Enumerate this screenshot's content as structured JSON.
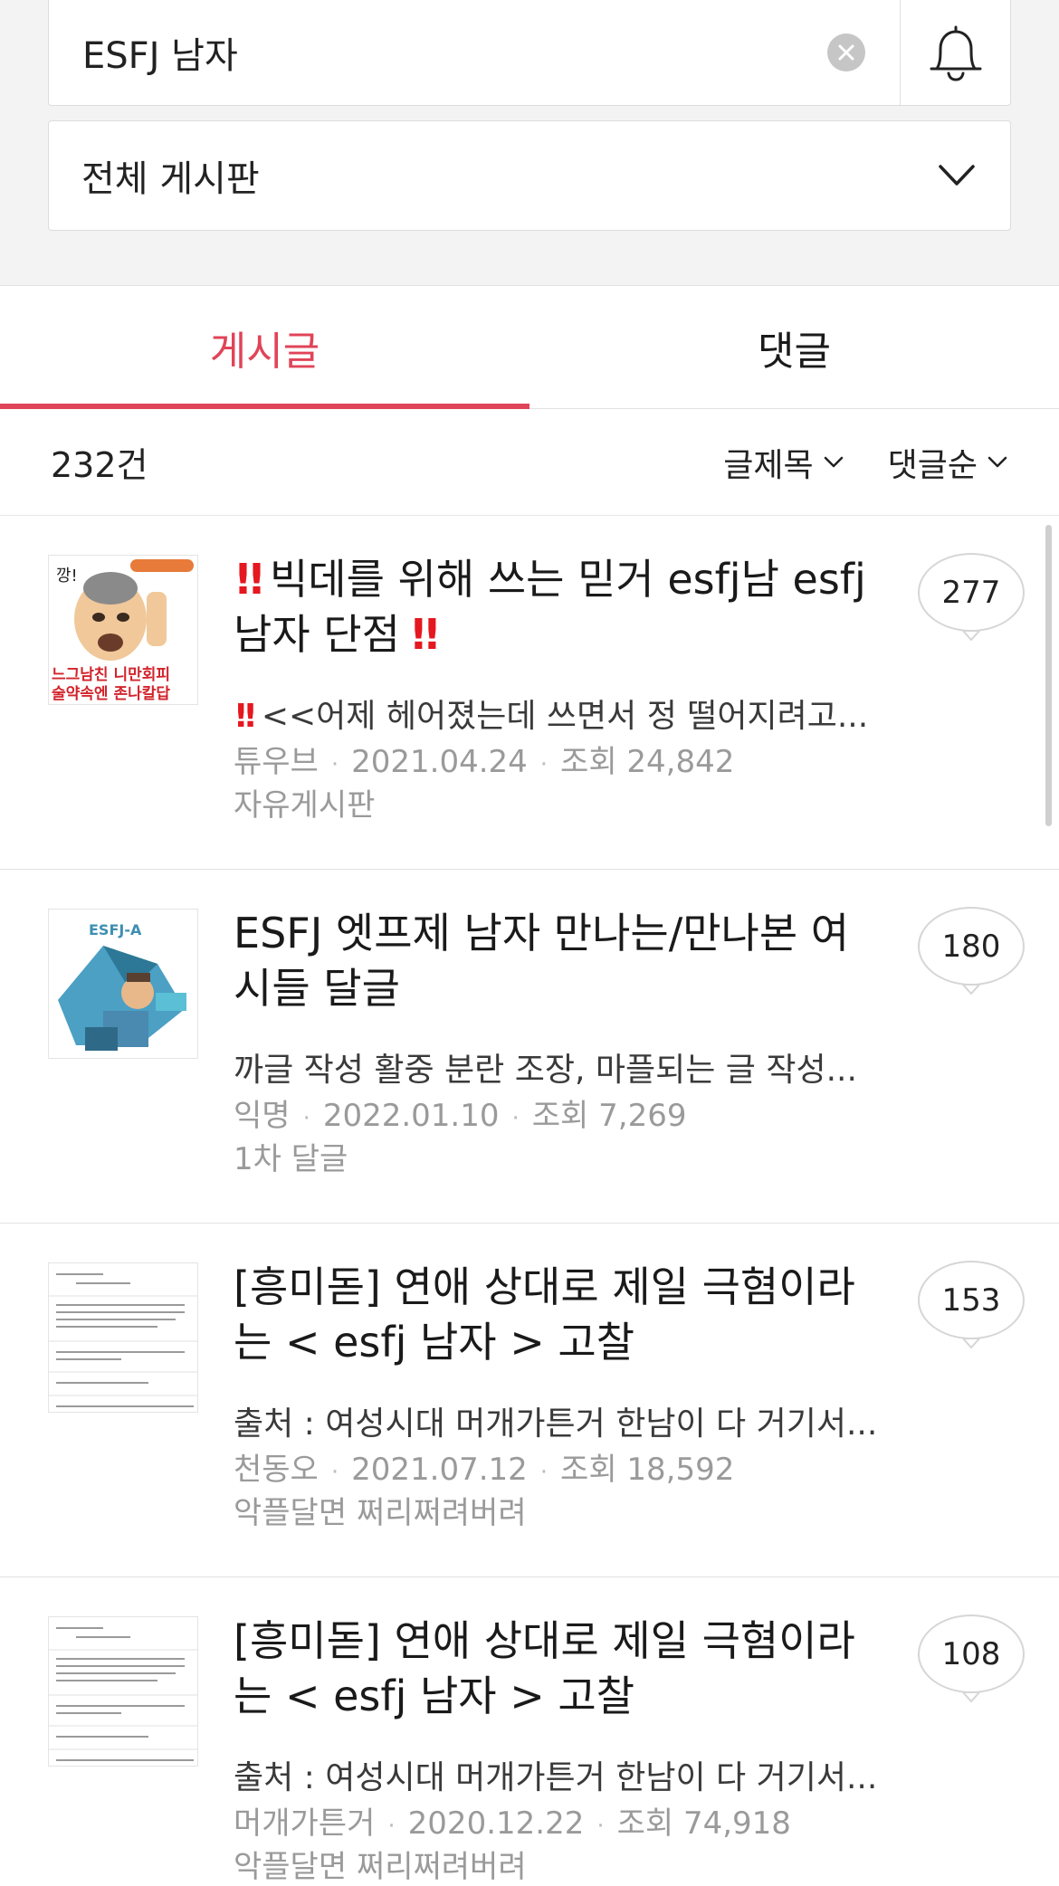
{
  "search": {
    "value": "ESFJ 남자",
    "board_filter": "전체 게시판"
  },
  "tabs": [
    {
      "label": "게시글",
      "active": true
    },
    {
      "label": "댓글",
      "active": false
    }
  ],
  "results": {
    "count": "232건",
    "sort_field": "글제목",
    "sort_order": "댓글순"
  },
  "posts": [
    {
      "title": "빅데를 위해 쓰는 믿거 esfj남 esfj 남자 단점",
      "title_prefix": "!!",
      "title_suffix": "!!",
      "preview": "<<어제 헤어졌는데 쓰면서 정 떨어지려고...",
      "preview_prefix": "!!",
      "author": "튜우브",
      "date": "2021.04.24",
      "views": "조회 24,842",
      "board": "자유게시판",
      "comments": "277",
      "thumb_text_top": "깡!",
      "thumb_text_bottom": "느그남친 니만회피 술약속엔 존나칼답"
    },
    {
      "title": "ESFJ 엣프제 남자 만나는/만나본 여시들 달글",
      "preview": "까글 작성 활중 분란 조장, 마플되는 글 작성...",
      "author": "익명",
      "date": "2022.01.10",
      "views": "조회 7,269",
      "board": "1차 달글",
      "comments": "180",
      "thumb_text_top": "ESFJ-A"
    },
    {
      "title": "[흥미돋] 연애 상대로 제일 극혐이라는 < esfj 남자 > 고찰",
      "preview": "출처 : 여성시대 머개가튼거 한남이 다 거기서...",
      "author": "천동오",
      "date": "2021.07.12",
      "views": "조회 18,592",
      "board": "악플달면 쩌리쩌려버려",
      "comments": "153"
    },
    {
      "title": "[흥미돋] 연애 상대로 제일 극혐이라는 < esfj 남자 > 고찰",
      "preview": "출처 : 여성시대 머개가튼거 한남이 다 거기서...",
      "author": "머개가튼거",
      "date": "2020.12.22",
      "views": "조회 74,918",
      "board": "악플달면 쩌리쩌려버려",
      "comments": "108"
    }
  ],
  "colors": {
    "accent": "#e04458",
    "background": "#f3f3f3",
    "meta_text": "#9a9a9a"
  }
}
